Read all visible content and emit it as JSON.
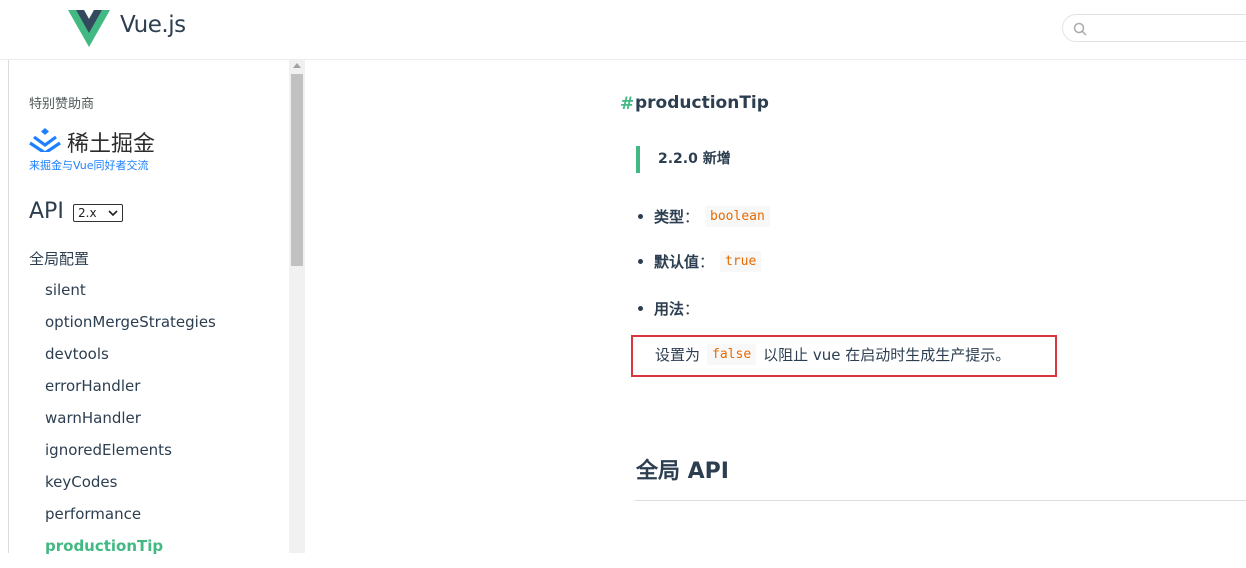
{
  "header": {
    "brand": "Vue.js",
    "search_placeholder": ""
  },
  "sidebar": {
    "sponsor_label": "特别赞助商",
    "sponsor_name": "稀土掘金",
    "sponsor_tagline": "来掘金与Vue同好者交流",
    "api_title": "API",
    "version_selected": "2.x",
    "section_label": "全局配置",
    "items": [
      {
        "label": "silent"
      },
      {
        "label": "optionMergeStrategies"
      },
      {
        "label": "devtools"
      },
      {
        "label": "errorHandler"
      },
      {
        "label": "warnHandler"
      },
      {
        "label": "ignoredElements"
      },
      {
        "label": "keyCodes"
      },
      {
        "label": "performance"
      },
      {
        "label": "productionTip",
        "active": true
      }
    ]
  },
  "content": {
    "anchor": "#",
    "title": "productionTip",
    "tip": "2.2.0 新增",
    "type_label": "类型",
    "type_value": "boolean",
    "default_label": "默认值",
    "default_value": "true",
    "usage_label": "用法",
    "colon": "：",
    "usage_prefix": "设置为",
    "usage_code": "false",
    "usage_suffix": "以阻止 vue 在启动时生成生产提示。",
    "next_heading": "全局 API"
  },
  "colors": {
    "accent": "#42b983",
    "text": "#2c3e50",
    "code": "#e96900",
    "highlight_border": "#d9363e",
    "sponsor_blue": "#1e80ff"
  }
}
